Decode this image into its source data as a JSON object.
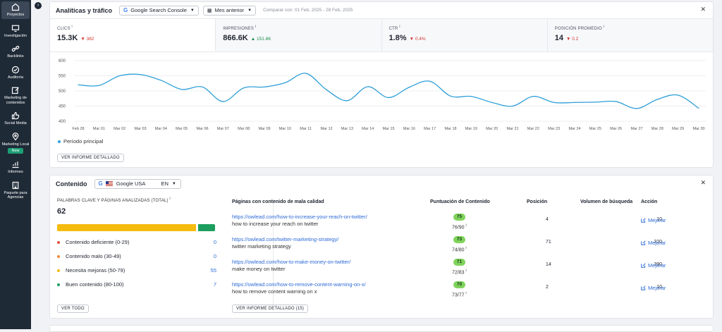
{
  "sidebar": {
    "items": [
      {
        "label": "Proyectos",
        "icon": "home-icon",
        "active": true
      },
      {
        "label": "Investigación",
        "icon": "monitor-icon"
      },
      {
        "label": "Backlinks",
        "icon": "link-icon"
      },
      {
        "label": "Auditoría",
        "icon": "check-circle-icon"
      },
      {
        "label": "Marketing de contenidos",
        "icon": "edit-icon"
      },
      {
        "label": "Social Media",
        "icon": "thumbs-up-icon"
      },
      {
        "label": "Marketing Local",
        "icon": "map-pin-icon"
      },
      {
        "label": "Informes",
        "icon": "chart-icon"
      },
      {
        "label": "Paquete para Agencias",
        "icon": "building-icon"
      }
    ],
    "new_badge": "New"
  },
  "analytics": {
    "title": "Analíticas y tráfico",
    "source_select": "Google Search Console",
    "period_select": "Mes anterior",
    "compare_text": "Comparar con: 01 Feb, 2025 - 28 Feb, 2025",
    "metrics": [
      {
        "label": "CLICS",
        "value": "15.3K",
        "delta": "382",
        "trend": "down"
      },
      {
        "label": "IMPRESIONES",
        "value": "866.6K",
        "delta": "151.8K",
        "trend": "up"
      },
      {
        "label": "CTR",
        "value": "1.8%",
        "delta": "0.4%",
        "trend": "down"
      },
      {
        "label": "POSICIÓN PROMEDIO",
        "value": "14",
        "delta": "0.2",
        "trend": "down"
      }
    ],
    "legend": "Período principal",
    "detail_button": "VER INFORME DETALLADO"
  },
  "chart_data": {
    "type": "line",
    "title": "",
    "xlabel": "",
    "ylabel": "",
    "ylim": [
      400,
      600
    ],
    "yticks": [
      400,
      450,
      500,
      550,
      600
    ],
    "grid": true,
    "legend_position": "bottom-left",
    "color": "#2f9fd8",
    "x": [
      "Feb 28",
      "Mar 01",
      "Mar 02",
      "Mar 03",
      "Mar 04",
      "Mar 05",
      "Mar 06",
      "Mar 07",
      "Mar 08",
      "Mar 09",
      "Mar 10",
      "Mar 11",
      "Mar 12",
      "Mar 13",
      "Mar 14",
      "Mar 15",
      "Mar 16",
      "Mar 17",
      "Mar 18",
      "Mar 19",
      "Mar 20",
      "Mar 21",
      "Mar 22",
      "Mar 23",
      "Mar 24",
      "Mar 25",
      "Mar 26",
      "Mar 27",
      "Mar 28",
      "Mar 29",
      "Mar 30"
    ],
    "series": [
      {
        "name": "Período principal",
        "values": [
          520,
          518,
          550,
          554,
          535,
          505,
          513,
          465,
          510,
          513,
          527,
          558,
          504,
          468,
          514,
          478,
          512,
          532,
          483,
          482,
          462,
          450,
          482,
          462,
          462,
          463,
          465,
          442,
          472,
          486,
          443
        ]
      }
    ]
  },
  "content": {
    "title": "Contenido",
    "db_select": "Google USA",
    "lang": "EN",
    "keywords_header": "PALABRAS CLAVE Y PÁGINAS ANALIZADAS (TOTAL)",
    "keywords_total": "62",
    "levels": [
      {
        "label": "Contenido deficiente (0-29)",
        "count": "0",
        "color": "#e0533f"
      },
      {
        "label": "Contenido malo (30-49)",
        "count": "0",
        "color": "#f08a3c"
      },
      {
        "label": "Necesita mejoras (50-79)",
        "count": "55",
        "color": "#f5bb0f"
      },
      {
        "label": "Buen contenido (80-100)",
        "count": "7",
        "color": "#1d9e5e"
      }
    ],
    "view_all_button": "VER TODO",
    "detail_button": "VER INFORME DETALLADO (15)",
    "columns": {
      "pages": "Páginas con contenido de mala calidad",
      "score": "Puntuación de Contenido",
      "position": "Posición",
      "volume": "Volumen de búsqueda",
      "action": "Acción"
    },
    "rows": [
      {
        "url": "https://owlead.com/how-to-increase-your-reach-on-twitter/",
        "keyword": "how to increase your reach on twitter",
        "score": "75",
        "fraction": "76/90",
        "position": "4",
        "volume": "10",
        "action": "Mejorar"
      },
      {
        "url": "https://owlead.com/twitter-marketing-strategy/",
        "keyword": "twitter marketing strategy",
        "score": "73",
        "fraction": "74/80",
        "position": "71",
        "volume": "320",
        "action": "Mejorar"
      },
      {
        "url": "https://owlead.com/how-to-make-money-on-twitter/",
        "keyword": "make money on twitter",
        "score": "71",
        "fraction": "72/83",
        "position": "14",
        "volume": "390",
        "action": "Mejorar"
      },
      {
        "url": "https://owlead.com/how-to-remove-content-warning-on-x/",
        "keyword": "how to remove content warning on x",
        "score": "70",
        "fraction": "73/77",
        "position": "2",
        "volume": "10",
        "action": "Mejorar"
      }
    ]
  }
}
